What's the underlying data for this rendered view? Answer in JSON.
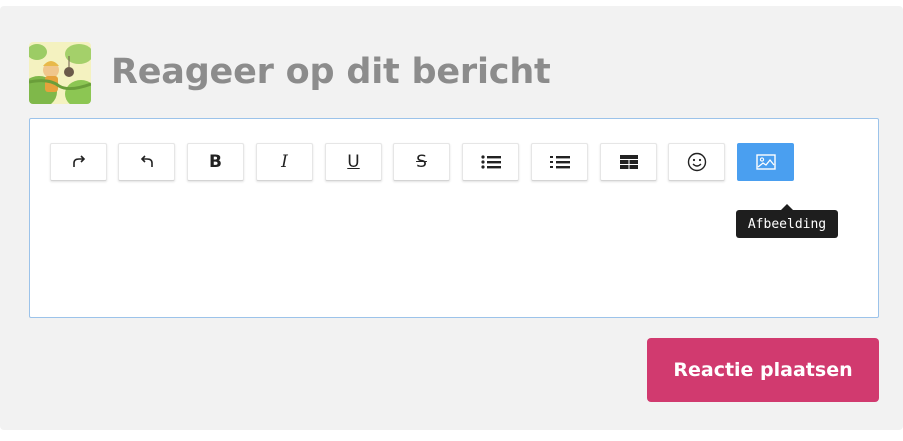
{
  "comment": {
    "heading": "Reageer op dit bericht",
    "avatar_icon": "user-avatar-illustration"
  },
  "toolbar": {
    "buttons": [
      {
        "name": "redo",
        "icon": "redo-arrow-icon",
        "glyph": "↷"
      },
      {
        "name": "undo",
        "icon": "undo-arrow-icon",
        "glyph": "↶"
      },
      {
        "name": "bold",
        "icon": "bold-icon",
        "glyph": "B"
      },
      {
        "name": "italic",
        "icon": "italic-icon",
        "glyph": "I"
      },
      {
        "name": "underline",
        "icon": "underline-icon",
        "glyph": "U"
      },
      {
        "name": "strikethrough",
        "icon": "strikethrough-icon",
        "glyph": "S"
      },
      {
        "name": "bullet-list",
        "icon": "bullet-list-icon",
        "glyph": ""
      },
      {
        "name": "numbered-list",
        "icon": "numbered-list-icon",
        "glyph": ""
      },
      {
        "name": "table",
        "icon": "table-icon",
        "glyph": ""
      },
      {
        "name": "emoji",
        "icon": "smiley-icon",
        "glyph": "☺"
      },
      {
        "name": "image",
        "icon": "image-icon",
        "glyph": "",
        "active": true
      }
    ],
    "tooltip": "Afbeelding"
  },
  "editor": {
    "content": ""
  },
  "actions": {
    "submit_label": "Reactie plaatsen"
  },
  "colors": {
    "panel_bg": "#f2f2f2",
    "accent_blue": "#4a9ff0",
    "submit_pink": "#d13a6f",
    "heading_gray": "#8c8c8c"
  }
}
